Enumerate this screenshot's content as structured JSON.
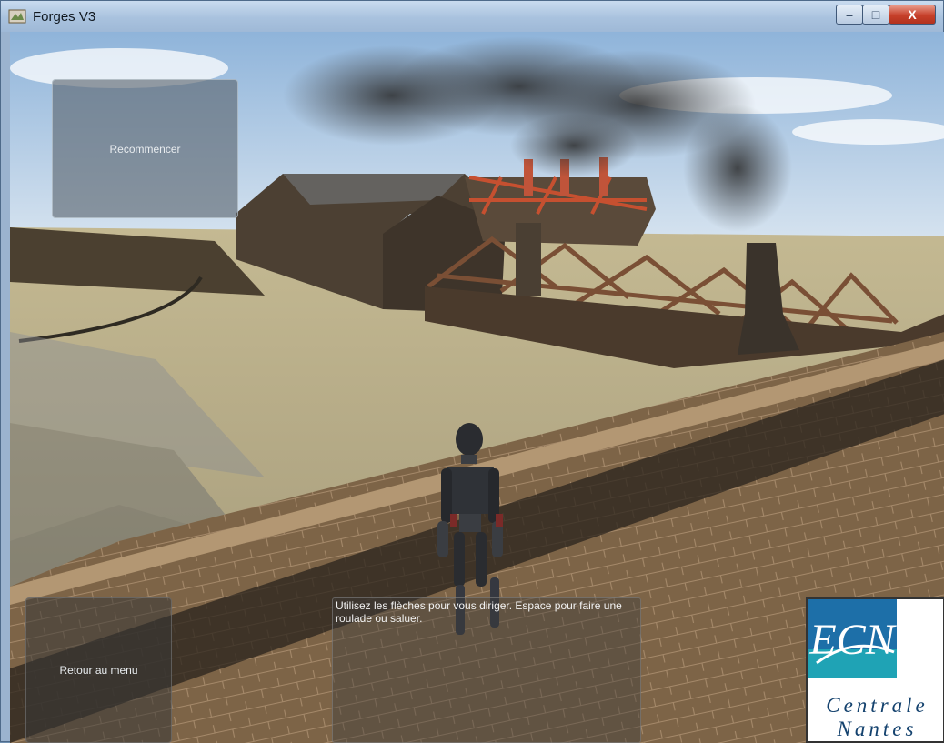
{
  "window": {
    "title": "Forges V3",
    "controls": {
      "minimize": "–",
      "maximize": "□",
      "close": "X"
    }
  },
  "hud": {
    "restart_label": "Recommencer",
    "menu_label": "Retour au menu",
    "help_text": "Utilisez les flèches pour vous diriger. Espace pour faire une roulade ou saluer."
  },
  "logo": {
    "monogram": "ECN",
    "line1": "Centrale",
    "line2": "Nantes"
  },
  "colors": {
    "sky": "#c7dcef",
    "ground": "#b3a888",
    "brick": "#8a6b48",
    "smoke": "#3a3a3a",
    "logo_blue": "#14426e",
    "logo_teal": "#1fa3b5"
  }
}
